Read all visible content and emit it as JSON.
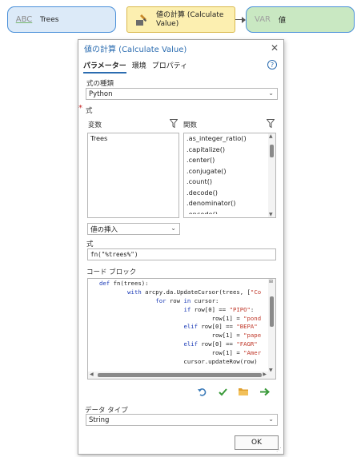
{
  "model": {
    "trees_node": {
      "icon": "abc-string-icon",
      "icon_text": "ABC",
      "label": "Trees"
    },
    "tool_node": {
      "icon": "calculate-value-tool-icon",
      "label_line1": "値の計算 (Calculate",
      "label_line2": "Value)"
    },
    "var_node": {
      "icon": "variable-icon",
      "icon_text": "VAR",
      "label": "値"
    }
  },
  "dialog": {
    "title": "値の計算 (Calculate Value)",
    "tabs": [
      {
        "label": "パラメーター",
        "active": true
      },
      {
        "label": "環境",
        "active": false
      },
      {
        "label": "プロパティ",
        "active": false
      }
    ],
    "expression_type": {
      "label": "式の種類",
      "value": "Python"
    },
    "expression_section": {
      "label": "式"
    },
    "variables": {
      "header": "変数",
      "items": [
        "Trees"
      ]
    },
    "functions": {
      "header": "関数",
      "items": [
        ".as_integer_ratio()",
        ".capitalize()",
        ".center()",
        ".conjugate()",
        ".count()",
        ".decode()",
        ".denominator()",
        ".encode()"
      ]
    },
    "insert_value": {
      "label": "値の挿入"
    },
    "expression": {
      "label": "式",
      "value": "fn(\"%trees%\")"
    },
    "code_block": {
      "label": "コード ブロック",
      "lines": [
        "def fn(trees):",
        "        with arcpy.da.UpdateCursor(trees, [\"Co",
        "                for row in cursor:",
        "                        if row[0] == \"PIPO\":",
        "                                row[1] = \"pond",
        "                        elif row[0] == \"BEPA\"",
        "                                row[1] = \"pape",
        "                        elif row[0] == \"FAGR\"",
        "                                row[1] = \"Amer",
        "                        cursor.updateRow(row)"
      ]
    },
    "data_type": {
      "label": "データ タイプ",
      "value": "String"
    },
    "ok_label": "OK",
    "colors": {
      "accent": "#2b6cb0",
      "required": "#c62828",
      "check": "#3a9a3a",
      "folder": "#e0a030"
    }
  }
}
